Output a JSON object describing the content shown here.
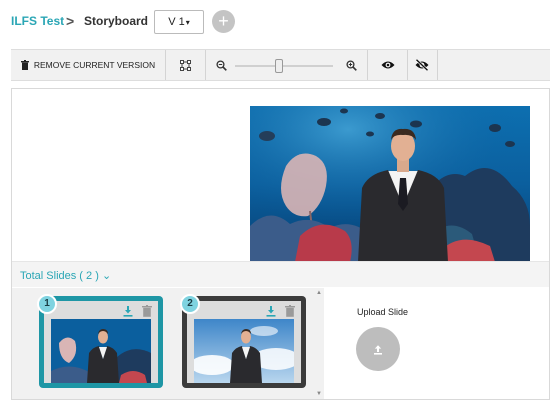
{
  "header": {
    "project": "ILFS Test",
    "separator": ">",
    "page": "Storyboard",
    "version": "V 1",
    "version_caret": "▾",
    "add_label": "+"
  },
  "toolbar": {
    "remove_label": "REMOVE CURRENT VERSION",
    "zoom_level": 0.45,
    "icons": [
      "trash-icon",
      "fit-screen-icon",
      "zoom-out-icon",
      "zoom-in-icon",
      "eye-icon",
      "eye-off-icon"
    ]
  },
  "slides": {
    "total_label": "Total Slides ( 2 )",
    "caret": "⌄",
    "items": [
      {
        "number": "1",
        "selected": true,
        "background": "underwater-reef"
      },
      {
        "number": "2",
        "selected": false,
        "background": "sky-clouds"
      }
    ]
  },
  "upload": {
    "label": "Upload Slide"
  },
  "colors": {
    "accent": "#2aa6b5",
    "selected_border": "#1e96a5",
    "unselected_border": "#3b3b3b",
    "badge": "#7fd3e0"
  }
}
